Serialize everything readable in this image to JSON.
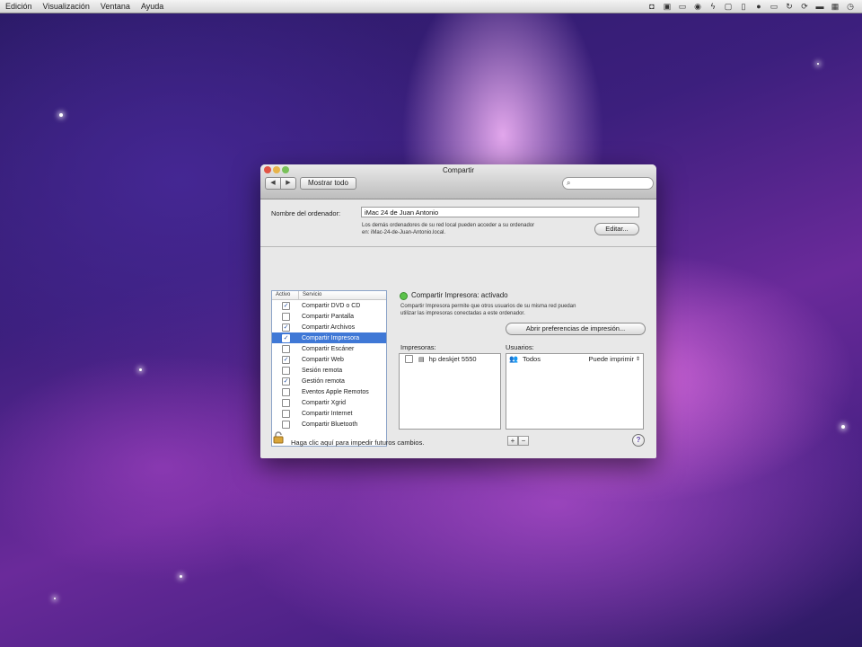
{
  "menubar": {
    "items": [
      "Edición",
      "Visualización",
      "Ventana",
      "Ayuda"
    ],
    "status_icons": [
      "camera-icon",
      "video-icon",
      "display-icon",
      "wifi-icon",
      "bluetooth-icon",
      "window-icon",
      "phone-icon",
      "record-icon",
      "eject-icon",
      "refresh-icon",
      "sync-icon",
      "battery-icon",
      "keyboard-icon",
      "clock-icon"
    ]
  },
  "window": {
    "title": "Compartir",
    "show_all": "Mostrar todo",
    "search_placeholder": "",
    "computer_name_label": "Nombre del ordenador:",
    "computer_name_value": "iMac 24 de Juan Antonio",
    "computer_name_note_line1": "Los demás ordenadores de su red local pueden acceder a su ordenador",
    "computer_name_note_line2": "en: iMac-24-de-Juan-Antonio.local.",
    "edit_button": "Editar..."
  },
  "services": {
    "header_active": "Activo",
    "header_service": "Servicio",
    "items": [
      {
        "label": "Compartir DVD o CD",
        "checked": true,
        "selected": false
      },
      {
        "label": "Compartir Pantalla",
        "checked": false,
        "selected": false
      },
      {
        "label": "Compartir Archivos",
        "checked": true,
        "selected": false
      },
      {
        "label": "Compartir Impresora",
        "checked": true,
        "selected": true
      },
      {
        "label": "Compartir Escáner",
        "checked": false,
        "selected": false
      },
      {
        "label": "Compartir Web",
        "checked": true,
        "selected": false
      },
      {
        "label": "Sesión remota",
        "checked": false,
        "selected": false
      },
      {
        "label": "Gestión remota",
        "checked": true,
        "selected": false
      },
      {
        "label": "Eventos Apple Remotos",
        "checked": false,
        "selected": false
      },
      {
        "label": "Compartir Xgrid",
        "checked": false,
        "selected": false
      },
      {
        "label": "Compartir Internet",
        "checked": false,
        "selected": false
      },
      {
        "label": "Compartir Bluetooth",
        "checked": false,
        "selected": false
      }
    ]
  },
  "detail": {
    "status": "Compartir Impresora: activado",
    "description_line1": "Compartir Impresora permite que otros usuarios de su misma red puedan",
    "description_line2": "utilizar las impresoras conectadas a este ordenador.",
    "open_prefs_button": "Abrir preferencias de impresión...",
    "printers_label": "Impresoras:",
    "printers": [
      {
        "name": "hp deskjet 5550",
        "checked": false
      }
    ],
    "users_label": "Usuarios:",
    "users": [
      {
        "name": "Todos",
        "permission": "Puede imprimir"
      }
    ],
    "add_label": "+",
    "remove_label": "−"
  },
  "footer": {
    "lock_text": "Haga clic aquí para impedir futuros cambios.",
    "help_label": "?"
  },
  "colors": {
    "selection": "#3f78d6",
    "status_green": "#5bc24a"
  }
}
